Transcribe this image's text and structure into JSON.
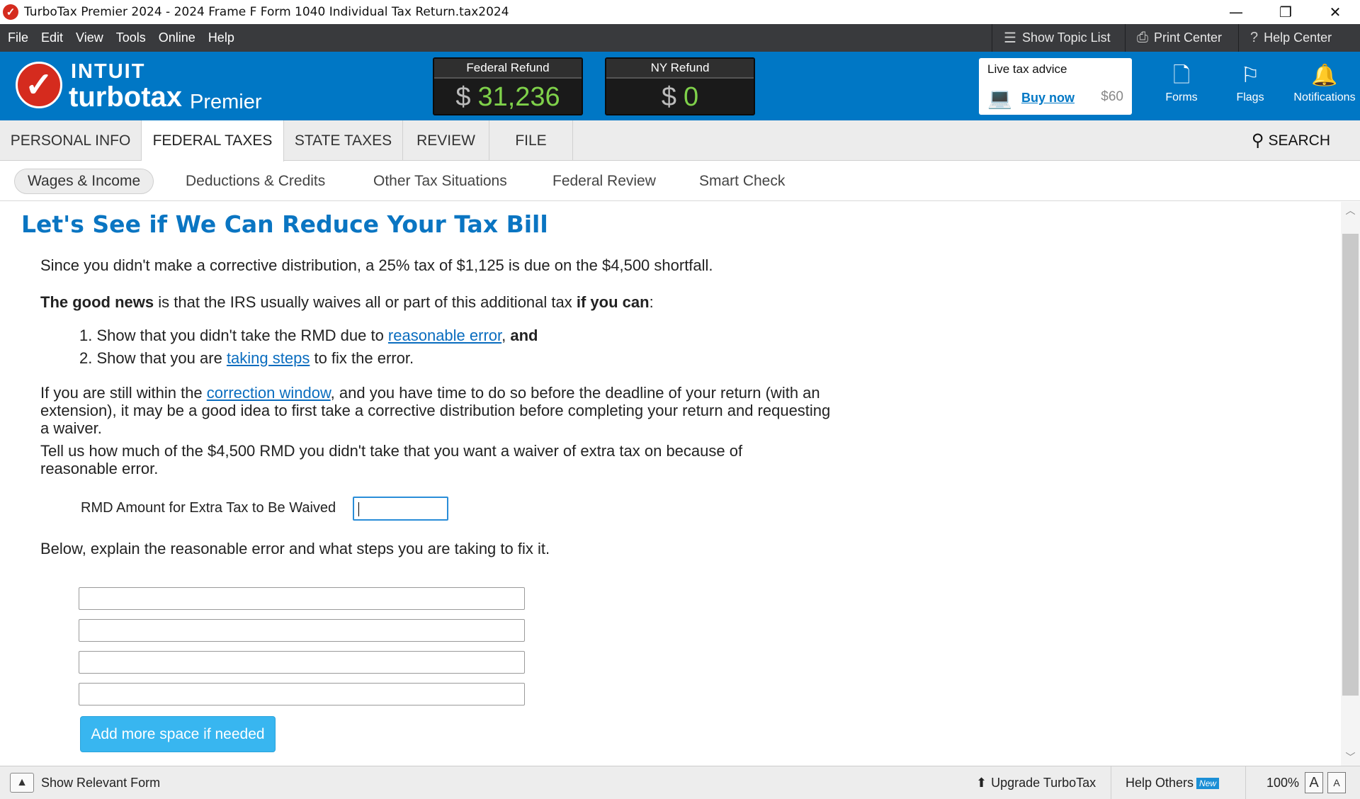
{
  "window": {
    "title": "TurboTax Premier 2024 - 2024 Frame F Form 1040  Individual Tax Return.tax2024",
    "minimize": "—",
    "restore": "❐",
    "close": "✕"
  },
  "menu": {
    "items": [
      "File",
      "Edit",
      "View",
      "Tools",
      "Online",
      "Help"
    ],
    "show_topic_list": "Show Topic List",
    "print_center": "Print Center",
    "help_center": "Help Center"
  },
  "header": {
    "brand_top": "INTUIT",
    "brand_main": "turbotax",
    "brand_edition": "Premier",
    "federal_refund_label": "Federal Refund",
    "federal_refund_currency": "$",
    "federal_refund_amount": "31,236",
    "ny_refund_label": "NY Refund",
    "ny_refund_currency": "$",
    "ny_refund_amount": "0",
    "live_advice_label": "Live tax advice",
    "buy_now": "Buy now",
    "price": "$60",
    "forms": "Forms",
    "flags": "Flags",
    "notifications": "Notifications",
    "accent": "#0077c5",
    "refund_color": "#7fd14a"
  },
  "tabs": {
    "items": [
      "PERSONAL INFO",
      "FEDERAL TAXES",
      "STATE TAXES",
      "REVIEW",
      "FILE"
    ],
    "active": "FEDERAL TAXES",
    "search": "SEARCH"
  },
  "subtabs": {
    "items": [
      "Wages & Income",
      "Deductions & Credits",
      "Other Tax Situations",
      "Federal Review",
      "Smart Check"
    ],
    "active": "Wages & Income"
  },
  "main": {
    "title": "Let's See if We Can Reduce Your Tax Bill",
    "p1": "Since you didn't make a corrective distribution, a 25% tax of $1,125 is due on the $4,500 shortfall.",
    "p2_bold1": "The good news",
    "p2_mid": " is that the IRS usually waives all or part of this additional tax ",
    "p2_bold2": "if you can",
    "p2_end": ":",
    "li1_num": "1.",
    "li1_pre": "Show that you didn't take the RMD due to ",
    "li1_link": "reasonable error",
    "li1_sep": ", ",
    "li1_bold": "and",
    "li2_num": "2.",
    "li2_pre": "Show that you are ",
    "li2_link": "taking steps",
    "li2_post": " to fix the error.",
    "p3_pre": "If you are still within the ",
    "p3_link": "correction window",
    "p3_post": ", and you have time to do so before the deadline of your return (with an extension), it may be a good idea to first take a corrective distribution before completing your return and requesting a waiver.",
    "p4": "Tell us how much of the $4,500 RMD you didn't take that you want a waiver of extra tax on because of reasonable error.",
    "rmd_label": "RMD Amount for Extra Tax to Be Waived",
    "rmd_value": "",
    "p5": "Below, explain the reasonable error and what steps you are taking to fix it.",
    "explain_lines": [
      "",
      "",
      "",
      ""
    ],
    "add_more": "Add more space if needed"
  },
  "statusbar": {
    "show_form": "Show Relevant Form",
    "upgrade": "Upgrade TurboTax",
    "help_others": "Help Others",
    "new_badge": "New",
    "zoom": "100%",
    "zoom_large": "A",
    "zoom_small": "A"
  }
}
